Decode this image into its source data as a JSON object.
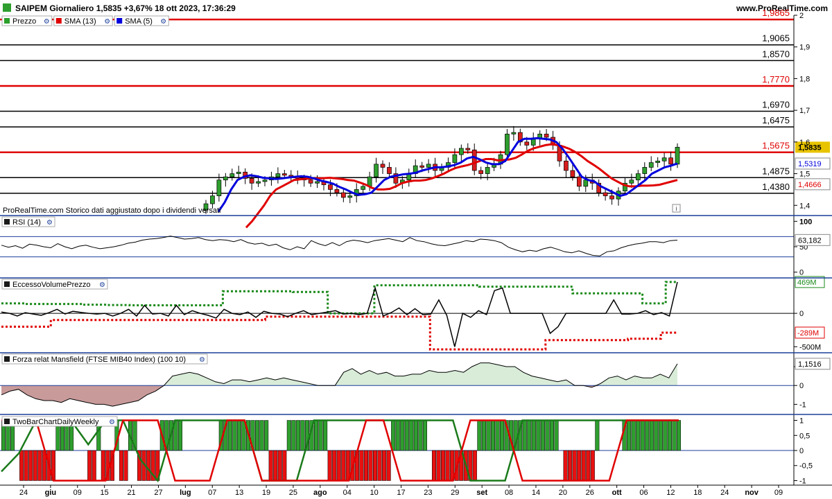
{
  "header": {
    "title": "SAIPEM Giornaliero 1,5835 +3,67% 18 ott 2023, 17:36:29",
    "brand": "www.ProRealTime.com"
  },
  "price_panel": {
    "legend": [
      {
        "label": "Prezzo",
        "color": "#2ca02c"
      },
      {
        "label": "SMA (13)",
        "color": "#e00000"
      },
      {
        "label": "SMA (5)",
        "color": "#0000dd"
      }
    ],
    "note": "ProRealTime.com  Storico dati aggiustato dopo i dividendi versati",
    "info_icon": "i"
  },
  "colors": {
    "up": "#2e9e2e",
    "down": "#d81e1e",
    "sma13": "#e00000",
    "sma5": "#0000dd",
    "resistance_red": "#e00000",
    "level_black": "#000000",
    "separator": "#1c3f99",
    "price_badge": "#e8c400"
  },
  "chart_data": [
    {
      "type": "candlestick",
      "title": "SAIPEM Giornaliero",
      "ylim": [
        1.37,
        2.0
      ],
      "y_ticks": [
        {
          "v": 2.0,
          "label": "2"
        },
        {
          "v": 1.9,
          "label": "1,9"
        },
        {
          "v": 1.8,
          "label": "1,8"
        },
        {
          "v": 1.7,
          "label": "1,7"
        },
        {
          "v": 1.6,
          "label": "1,6"
        },
        {
          "v": 1.5,
          "label": "1,5"
        },
        {
          "v": 1.4,
          "label": "1,4"
        }
      ],
      "levels": [
        {
          "v": 1.9865,
          "label": "1,9865",
          "color": "red"
        },
        {
          "v": 1.9065,
          "label": "1,9065",
          "color": "black"
        },
        {
          "v": 1.857,
          "label": "1,8570",
          "color": "black"
        },
        {
          "v": 1.777,
          "label": "1,7770",
          "color": "red"
        },
        {
          "v": 1.697,
          "label": "1,6970",
          "color": "black"
        },
        {
          "v": 1.6475,
          "label": "1,6475",
          "color": "black"
        },
        {
          "v": 1.5675,
          "label": "1,5675",
          "color": "red"
        },
        {
          "v": 1.4875,
          "label": "1,4875",
          "color": "black"
        },
        {
          "v": 1.438,
          "label": "1,4380",
          "color": "black"
        }
      ],
      "badges": [
        {
          "label": "1,5835",
          "v": 1.5835,
          "style": "price"
        },
        {
          "label": "1,5319",
          "v": 1.5319,
          "style": "sma5"
        },
        {
          "label": "1,4666",
          "v": 1.4666,
          "style": "sma13"
        }
      ],
      "x_ticks": [
        "24",
        "giu",
        "09",
        "15",
        "21",
        "27",
        "lug",
        "07",
        "13",
        "19",
        "25",
        "ago",
        "04",
        "10",
        "17",
        "23",
        "29",
        "set",
        "08",
        "14",
        "20",
        "26",
        "ott",
        "06",
        "12",
        "18",
        "24",
        "nov",
        "09"
      ],
      "x_tick_major": [
        "giu",
        "lug",
        "ago",
        "set",
        "ott",
        "nov"
      ],
      "close": [
        1.405,
        1.43,
        1.48,
        1.49,
        1.5,
        1.505,
        1.485,
        1.47,
        1.475,
        1.48,
        1.49,
        1.5,
        1.495,
        1.49,
        1.485,
        1.48,
        1.47,
        1.475,
        1.465,
        1.45,
        1.44,
        1.425,
        1.43,
        1.45,
        1.46,
        1.49,
        1.53,
        1.52,
        1.5,
        1.47,
        1.48,
        1.5,
        1.525,
        1.52,
        1.53,
        1.51,
        1.52,
        1.535,
        1.56,
        1.58,
        1.575,
        1.51,
        1.5,
        1.52,
        1.53,
        1.56,
        1.625,
        1.63,
        1.6,
        1.59,
        1.61,
        1.625,
        1.615,
        1.59,
        1.54,
        1.51,
        1.49,
        1.46,
        1.48,
        1.47,
        1.44,
        1.43,
        1.42,
        1.445,
        1.47,
        1.48,
        1.5,
        1.52,
        1.535,
        1.54,
        1.55,
        1.53,
        1.5835
      ],
      "sma13": [
        1.33,
        1.35,
        1.375,
        1.4,
        1.43,
        1.45,
        1.46,
        1.47,
        1.48,
        1.482,
        1.484,
        1.485,
        1.485,
        1.486,
        1.487,
        1.485,
        1.483,
        1.48,
        1.478,
        1.472,
        1.465,
        1.455,
        1.45,
        1.45,
        1.452,
        1.46,
        1.47,
        1.475,
        1.478,
        1.478,
        1.48,
        1.485,
        1.492,
        1.5,
        1.51,
        1.518,
        1.523,
        1.527,
        1.533,
        1.54,
        1.546,
        1.546,
        1.542,
        1.543,
        1.545,
        1.55,
        1.56,
        1.572,
        1.58,
        1.585,
        1.59,
        1.593,
        1.59,
        1.585,
        1.578,
        1.568,
        1.555,
        1.54,
        1.528,
        1.515,
        1.5,
        1.485,
        1.475,
        1.465,
        1.46,
        1.46,
        1.462,
        1.462,
        1.463,
        1.465,
        1.47,
        1.475,
        1.48
      ],
      "sma5": [
        1.38,
        1.41,
        1.45,
        1.48,
        1.49,
        1.495,
        1.492,
        1.487,
        1.485,
        1.483,
        1.485,
        1.488,
        1.49,
        1.492,
        1.49,
        1.485,
        1.478,
        1.474,
        1.468,
        1.458,
        1.45,
        1.44,
        1.433,
        1.435,
        1.44,
        1.46,
        1.48,
        1.49,
        1.494,
        1.498,
        1.5,
        1.503,
        1.51,
        1.515,
        1.52,
        1.52,
        1.523,
        1.527,
        1.535,
        1.548,
        1.553,
        1.545,
        1.535,
        1.53,
        1.53,
        1.54,
        1.57,
        1.6,
        1.61,
        1.61,
        1.612,
        1.61,
        1.608,
        1.6,
        1.578,
        1.55,
        1.52,
        1.49,
        1.48,
        1.475,
        1.46,
        1.45,
        1.44,
        1.43,
        1.435,
        1.45,
        1.465,
        1.48,
        1.5,
        1.51,
        1.52,
        1.525,
        1.532
      ]
    },
    {
      "type": "line",
      "title": "RSI (14)",
      "ylim": [
        0,
        100
      ],
      "y_ticks": [
        {
          "v": 100,
          "label": "100"
        },
        {
          "v": 50,
          "label": "50"
        },
        {
          "v": 0,
          "label": "0"
        }
      ],
      "bands": [
        70,
        30
      ],
      "badge": {
        "label": "63,182",
        "v": 63.182
      },
      "values": [
        53,
        49,
        52,
        47,
        55,
        53,
        50,
        48,
        56,
        50,
        46,
        51,
        53,
        49,
        46,
        48,
        50,
        53,
        57,
        59,
        63,
        65,
        66,
        68,
        71,
        68,
        65,
        66,
        68,
        64,
        62,
        64,
        63,
        60,
        64,
        58,
        55,
        57,
        52,
        55,
        48,
        44,
        50,
        46,
        62,
        56,
        52,
        58,
        52,
        60,
        63,
        61,
        58,
        62,
        64,
        66,
        63,
        60,
        68,
        62,
        60,
        56,
        53,
        52,
        55,
        58,
        62,
        60,
        65,
        64,
        62,
        58,
        49,
        44,
        40,
        43,
        41,
        46,
        49,
        45,
        40,
        38,
        42,
        37,
        33,
        32,
        40,
        42,
        48,
        52,
        55,
        57,
        60,
        60,
        58,
        62,
        63
      ]
    },
    {
      "type": "line",
      "title": "EccessoVolumePrezzo",
      "ylim": [
        -580,
        520
      ],
      "y_ticks": [
        {
          "v": 0,
          "label": "0"
        },
        {
          "v": -500,
          "label": "-500M"
        }
      ],
      "badges": [
        {
          "label": "469M",
          "v": 469,
          "style": "green"
        },
        {
          "label": "-289M",
          "v": -289,
          "style": "red"
        }
      ],
      "top_label": "469M",
      "line": [
        20,
        0,
        -40,
        10,
        -10,
        -30,
        10,
        60,
        -10,
        30,
        15,
        0,
        -10,
        0,
        -40,
        0,
        60,
        -40,
        120,
        -10,
        0,
        -40,
        120,
        -20,
        40,
        0,
        -30,
        -70,
        60,
        0,
        -20,
        20,
        -60,
        30,
        0,
        -10,
        -50,
        0,
        40,
        -20,
        0,
        20,
        40,
        -10,
        0,
        -20,
        0,
        380,
        -40,
        10,
        80,
        -20,
        70,
        -20,
        -10,
        200,
        -30,
        -500,
        0,
        -60,
        40,
        -20,
        340,
        380,
        0,
        0,
        0,
        0,
        0,
        -300,
        -200,
        0,
        0,
        0,
        0,
        0,
        0,
        200,
        -10,
        -10,
        0,
        40,
        -20,
        10,
        -40,
        469
      ],
      "upper": [
        150,
        150,
        140,
        140,
        140,
        140,
        140,
        130,
        130,
        125,
        125,
        120,
        120,
        120,
        120,
        120,
        120,
        120,
        120,
        330,
        330,
        330,
        330,
        330,
        330,
        320,
        320,
        320,
        0,
        0,
        0,
        0,
        420,
        420,
        420,
        420,
        420,
        420,
        420,
        420,
        420,
        400,
        400,
        400,
        400,
        400,
        400,
        400,
        400,
        300,
        300,
        300,
        300,
        300,
        300,
        150,
        150,
        469
      ],
      "lower": [
        -200,
        -200,
        -200,
        -100,
        -100,
        -100,
        -100,
        -100,
        -100,
        -100,
        -100,
        -100,
        -100,
        -100,
        -100,
        -100,
        -50,
        -50,
        -50,
        -50,
        -50,
        -50,
        -50,
        -50,
        -50,
        -50,
        -540,
        -540,
        -540,
        -540,
        -540,
        -540,
        -540,
        -400,
        -400,
        -400,
        -400,
        -400,
        -380,
        -380,
        -289
      ]
    },
    {
      "type": "area",
      "title": "Forza relat Mansfield (FTSE MIB40 Index) (100 10)",
      "ylim": [
        -1.5,
        1.7
      ],
      "y_ticks": [
        {
          "v": 1,
          "label": "1"
        },
        {
          "v": 0,
          "label": "0"
        },
        {
          "v": -1,
          "label": "-1"
        }
      ],
      "badge": {
        "label": "1,1516",
        "v": 1.1516
      },
      "values": [
        -0.5,
        -0.3,
        -0.2,
        -0.5,
        -0.7,
        -0.8,
        -0.8,
        -0.9,
        -0.7,
        -0.8,
        -0.9,
        -1.0,
        -1.0,
        -1.1,
        -1.0,
        -0.9,
        -0.8,
        -0.5,
        -0.3,
        0.0,
        0.5,
        0.6,
        0.7,
        0.6,
        0.4,
        0.2,
        0.1,
        0.3,
        0.3,
        0.2,
        0.3,
        0.4,
        0.3,
        0.4,
        0.3,
        0.2,
        0.1,
        0.0,
        0.0,
        0.0,
        0.7,
        0.9,
        0.6,
        0.8,
        0.6,
        0.7,
        0.5,
        0.5,
        0.6,
        0.6,
        0.8,
        0.7,
        0.7,
        0.8,
        0.7,
        1.0,
        1.2,
        1.2,
        1.1,
        1.0,
        1.0,
        0.7,
        0.5,
        0.4,
        0.3,
        0.2,
        0.3,
        0.0,
        0.0,
        -0.1,
        0.1,
        0.4,
        0.5,
        0.3,
        0.5,
        0.4,
        0.4,
        0.6,
        0.4,
        1.1516
      ]
    },
    {
      "type": "bar",
      "title": "TwoBarChartDailyWeekly",
      "ylim": [
        -1.15,
        1.15
      ],
      "y_ticks": [
        {
          "v": 1,
          "label": "1"
        },
        {
          "v": 0.5,
          "label": "0,5"
        },
        {
          "v": 0,
          "label": "0"
        },
        {
          "v": -0.5,
          "label": "-0,5"
        },
        {
          "v": -1,
          "label": "-1"
        }
      ],
      "daily": [
        1,
        1,
        1,
        0,
        -1,
        -1,
        -1,
        -1,
        -1,
        -1,
        -1,
        -1,
        1,
        1,
        1,
        1,
        0,
        0,
        0,
        -1,
        -1,
        1,
        -1,
        -1,
        -1,
        1,
        -1,
        -1,
        1,
        1,
        -1,
        -1,
        -1,
        -1,
        -1,
        1,
        1,
        1,
        1,
        1,
        0,
        0,
        0,
        0,
        0,
        0,
        0,
        0,
        1,
        1,
        1,
        1,
        1,
        1,
        1,
        1,
        1,
        1,
        1,
        -1,
        -1,
        -1,
        -1,
        1,
        1,
        1,
        1,
        1,
        1,
        1,
        1,
        1,
        -1,
        -1,
        -1,
        -1,
        -1,
        -1,
        -1,
        -1,
        -1,
        -1,
        -1,
        -1,
        -1,
        -1,
        1,
        1,
        1,
        1,
        1,
        1,
        1,
        1,
        0,
        -1,
        -1,
        -1,
        -1,
        -1,
        -1,
        -1,
        -1,
        -1,
        -1,
        1,
        1,
        1,
        1,
        1,
        1,
        1,
        1,
        1,
        1,
        1,
        1,
        1,
        1,
        1,
        1,
        1,
        1,
        0,
        -1,
        -1,
        -1,
        -1,
        -1,
        -1,
        -1,
        1,
        0,
        0,
        0,
        0,
        0,
        1,
        1,
        1,
        1,
        1,
        1,
        1,
        1,
        1,
        1,
        1,
        1,
        1
      ],
      "weekly_green": [
        -0.7,
        -0.1,
        1,
        1,
        1,
        0.2,
        1,
        1,
        -0.3,
        -1,
        1,
        1,
        1,
        1,
        1,
        -1,
        -1,
        -1,
        1,
        1,
        1,
        1,
        1,
        1,
        1,
        1,
        1,
        -1,
        -1,
        -1,
        1,
        1,
        1,
        1,
        1,
        1,
        1,
        1,
        1,
        1
      ],
      "weekly_red": [
        1,
        1,
        1,
        -1,
        -1,
        -1,
        -1,
        1,
        1,
        1,
        -1,
        -1,
        -1,
        1,
        1,
        -1,
        -1,
        -1,
        -1,
        -1,
        -1,
        1,
        1,
        -1,
        -1,
        -1,
        -1,
        1,
        1,
        1,
        -1,
        -1,
        -1,
        -1,
        -1,
        -1,
        1,
        1,
        1,
        1
      ]
    }
  ]
}
